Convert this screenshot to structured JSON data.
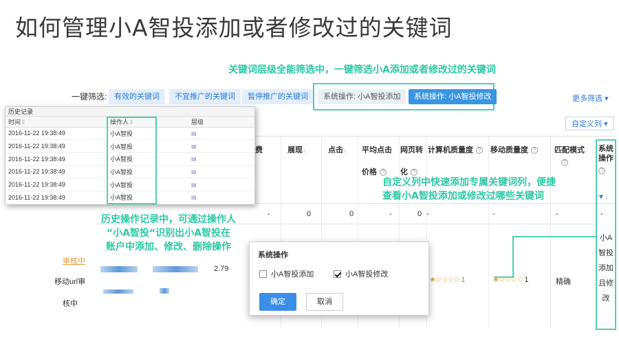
{
  "slide_title": "如何管理小A智投添加或者修改过的关键词",
  "callouts": {
    "top": "关键词层级全能筛选中，一键筛选小A添加或者修改过的关键词",
    "right_line1": "自定义列中快速添加专属关键词列，便捷",
    "right_line2": "查看小A智投添加或修改过哪些关键词",
    "left_line1": "历史操作记录中，可通过操作人",
    "left_line2": "“小A智投“识别出小A智投在",
    "left_line3": "账户中添加、修改、删除操作"
  },
  "quick_filter": {
    "label": "一键筛选:",
    "buttons": [
      "有效的关键词",
      "不宜推广的关键词",
      "暂停推广的关键词",
      "系统操作: 小A智投添加",
      "系统操作: 小A智投修改"
    ],
    "more": "更多筛选",
    "custom_columns": "自定义列"
  },
  "grid": {
    "headers": {
      "cost_frag": "费",
      "impressions": "展现",
      "clicks": "点击",
      "avg_cpc_line1": "平均点击",
      "avg_cpc_line2": "价格",
      "conv_line1": "网页转",
      "conv_line2": "化",
      "pc_quality": "计算机质量度",
      "mobile_quality": "移动质量度",
      "match_line1": "匹配模式",
      "system_op_line1": "系统",
      "system_op_line2": "操作"
    },
    "summary_row": {
      "cost": "-",
      "impressions": "0",
      "clicks": "0",
      "avg_cpc": "-",
      "conv": "0",
      "pc_quality": "-",
      "mobile_quality": "-",
      "match": "-",
      "system_op": "-"
    },
    "data_row": {
      "left_link": "审核中",
      "left_text1": "移动url审",
      "left_text2": "核中",
      "value": "2.79",
      "pc_stars": "★☆☆☆☆",
      "pc_score": "1",
      "mobile_stars": "★☆☆☆☆",
      "mobile_score": "1",
      "match": "精确",
      "system_op": [
        "小A",
        "智投",
        "添加",
        "且修",
        "改"
      ]
    }
  },
  "history": {
    "title": "历史记录",
    "columns": [
      "时间",
      "操作人",
      "层级"
    ],
    "rows": [
      {
        "time": "2016-11-22 19:38:49",
        "operator": "小A智投"
      },
      {
        "time": "2016-11-22 19:38:49",
        "operator": "小A智投"
      },
      {
        "time": "2016-11-22 19:38:49",
        "operator": "小A智投"
      },
      {
        "time": "2016-11-22 19:38:49",
        "operator": "小A智投"
      },
      {
        "time": "2016-11-22 19:38:49",
        "operator": "小A智投"
      },
      {
        "time": "2016-11-22 19:38:49",
        "operator": "小A智投"
      }
    ]
  },
  "dialog": {
    "title": "系统操作",
    "option1": "小A智投添加",
    "option1_checked": false,
    "option2": "小A智投修改",
    "option2_checked": true,
    "confirm": "确定",
    "cancel": "取消"
  },
  "colors": {
    "accent_green": "#2ec8a6",
    "primary_blue": "#3a8ee6",
    "star_orange": "#e4a13d"
  }
}
